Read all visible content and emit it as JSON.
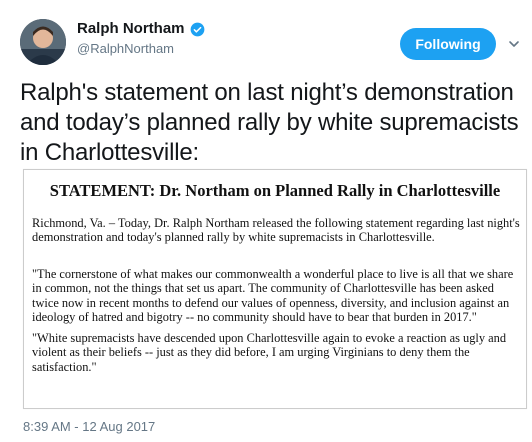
{
  "user": {
    "display_name": "Ralph Northam",
    "handle": "@RalphNortham"
  },
  "follow_button": {
    "label": "Following"
  },
  "tweet": {
    "text": "Ralph's statement on last night’s demonstration and today’s planned rally by white supremacists in Charlottesville:",
    "timestamp": "8:39 AM - 12 Aug 2017"
  },
  "statement": {
    "title": "STATEMENT: Dr. Northam on Planned Rally in Charlottesville",
    "paragraphs": [
      "Richmond, Va. – Today, Dr. Ralph Northam released the following statement regarding last night's demonstration and today's planned rally by white supremacists in Charlottesville.",
      "\"The cornerstone of what makes our commonwealth a wonderful place to live is all that we share in common, not the things that set us apart. The community of Charlottesville has been asked twice now in recent months to defend our values of openness, diversity, and inclusion against an ideology of hatred and bigotry -- no community should have to bear that burden in 2017.\"",
      "\"White supremacists have descended upon Charlottesville again to evoke a reaction as ugly and violent as their beliefs -- just as they did before, I am urging Virginians to deny them the satisfaction.\""
    ]
  },
  "colors": {
    "accent": "#1da1f2",
    "muted": "#657786"
  },
  "icons": [
    "avatar",
    "verified-badge-icon",
    "chevron-down-icon"
  ]
}
